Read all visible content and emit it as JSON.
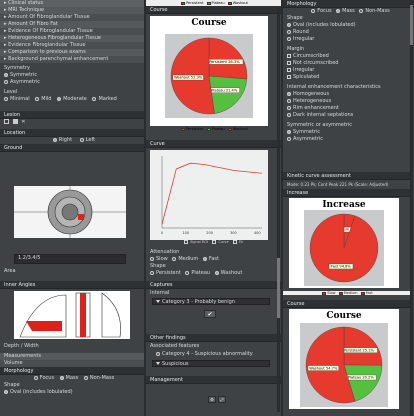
{
  "colA": {
    "topList": [
      "Clinical status",
      "MRI Technique",
      "Amount Of Fibroglandular Tissue",
      "Amount Of Fibro Fat",
      "Evidence Of Fibroglandular Tissue",
      "Heterogeneous Fibroglandular Tissue",
      "Evidence Fibroglandular Tissue",
      "Comparison to previous exams",
      "Background parenchymal enhancement"
    ],
    "symmetry_label": "Symmetry",
    "symmetry_opts": [
      "Symmetric",
      "Asymmetric"
    ],
    "level_label": "Level",
    "level_opts": [
      "Minimal",
      "Mild",
      "Moderate",
      "Marked"
    ],
    "lesion_hdr": "Lesion",
    "location_hdr": "Location",
    "side_opts": [
      "Right",
      "Left"
    ],
    "ground_hdr": "Ground",
    "coords": "1.2/3.4/5",
    "area_label": "Area",
    "inner_hdr": "Inner Angles",
    "depth_label": "Depth / Width",
    "lower_items": [
      "Measurements",
      "Volume"
    ],
    "morph_hdr": "Morphology",
    "morph_opts": [
      "Focus",
      "Mass",
      "Non-Mass"
    ],
    "shape_label": "Shape",
    "oval_label": "Oval (includes lobulated)"
  },
  "colB": {
    "top_legend": [
      "Persistent",
      "Plateau",
      "Washout"
    ],
    "course_hdr": "Course",
    "course_title": "Course",
    "course_slices": [
      {
        "label": "Persistent 26.3%",
        "value": 26.3,
        "color": "#e63a2e"
      },
      {
        "label": "Plateau 21.4%",
        "value": 21.4,
        "color": "#55c040"
      },
      {
        "label": "Washout 52.3%",
        "value": 52.3,
        "color": "#e63a2e"
      }
    ],
    "curve_hdr": "Curve",
    "curve_ticks": [
      "0",
      "100",
      "200",
      "300",
      "400"
    ],
    "curve_legend": [
      "Signal ROI",
      "Curve",
      "Fit"
    ],
    "curve_points": [
      [
        0,
        0.05
      ],
      [
        60,
        0.82
      ],
      [
        120,
        0.9
      ],
      [
        180,
        0.88
      ],
      [
        240,
        0.84
      ],
      [
        300,
        0.8
      ],
      [
        360,
        0.78
      ],
      [
        420,
        0.76
      ]
    ],
    "attn_label": "Attenuation",
    "attn_opts": [
      "Slow",
      "Medium",
      "Fast"
    ],
    "shape_label": "Shape",
    "shape_opts": [
      "Persistent",
      "Plateau",
      "Washout"
    ],
    "captures_hdr": "Captures",
    "captures_sub": "Internal",
    "captures_value": "Category 3 - Probably benign",
    "other_hdr": "Other findings",
    "other_sub": "Associated features",
    "other_value": "Category 4 - Suspicious abnormality",
    "other_field": "Suspicious",
    "mgmt_hdr": "Management"
  },
  "colC": {
    "morph_hdr": "Morphology",
    "morph_opts": [
      "Focus",
      "Mass",
      "Non-Mass"
    ],
    "shape_label": "Shape",
    "shape_opts": [
      "Oval (includes lobulated)",
      "Round",
      "Irregular"
    ],
    "margin_label": "Margin",
    "margin_opts": [
      "Circumscribed",
      "Not circumscribed",
      "Irregular",
      "Spiculated"
    ],
    "internal_label": "Internal enhancement characteristics",
    "internal_opts": [
      "Homogeneous",
      "Heterogeneous",
      "Rim enhancement",
      "Dark internal septations"
    ],
    "sym_label": "Symmetric or asymmetric",
    "sym_opts": [
      "Symmetric",
      "Asymmetric"
    ],
    "kinetic_hdr": "Kinetic curve assessment",
    "kinetic_info": "Mode: 0.23 Pk; Cont Peak 221 Pk (Scale: Adjusted)",
    "increase_hdr": "Increase",
    "increase_title": "Increase",
    "increase_slices": [
      {
        "label": "Medium 5.2%",
        "value": 5.2,
        "color": "#e63a2e"
      },
      {
        "label": "Fast 94.8%",
        "value": 94.8,
        "color": "#e63a2e"
      }
    ],
    "increase_legend": [
      "Slow",
      "Medium",
      "Fast"
    ],
    "course_hdr": "Course",
    "course_title": "Course",
    "course_slices": [
      {
        "label": "Persistent 25.1%",
        "value": 25.1,
        "color": "#e63a2e"
      },
      {
        "label": "Plateau 20.2%",
        "value": 20.2,
        "color": "#55c040"
      },
      {
        "label": "Washout 54.7%",
        "value": 54.7,
        "color": "#e63a2e"
      }
    ]
  }
}
